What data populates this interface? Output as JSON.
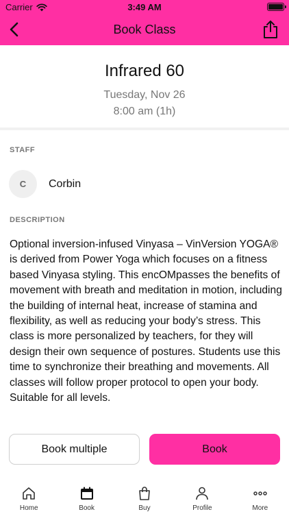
{
  "status_bar": {
    "carrier": "Carrier",
    "time": "3:49 AM",
    "battery_level": 1.0
  },
  "header": {
    "title": "Book Class",
    "back_icon": "chevron-left-icon",
    "share_icon": "share-icon"
  },
  "class_info": {
    "name": "Infrared 60",
    "date": "Tuesday, Nov 26",
    "time": "8:00 am (1h)"
  },
  "staff": {
    "section_label": "STAFF",
    "initial": "C",
    "name": "Corbin"
  },
  "description": {
    "section_label": "DESCRIPTION",
    "text": "Optional inversion-infused Vinyasa – VinVersion YOGA® is derived from Power Yoga which focuses on a fitness based Vinyasa styling.  This encOMpasses the benefits of movement with breath and meditation in motion, including the building of internal heat, increase of stamina and flexibility, as well as reducing your body’s stress. This class is more personalized by teachers, for they will design their own sequence of postures. Students use this time to synchronize their breathing and movements. All classes will follow proper protocol to open your body.  Suitable for all levels."
  },
  "actions": {
    "book_multiple_label": "Book multiple",
    "book_label": "Book"
  },
  "tabbar": {
    "items": [
      {
        "label": "Home",
        "icon": "home-icon"
      },
      {
        "label": "Book",
        "icon": "calendar-icon",
        "active": true
      },
      {
        "label": "Buy",
        "icon": "shopping-bag-icon"
      },
      {
        "label": "Profile",
        "icon": "person-icon"
      },
      {
        "label": "More",
        "icon": "ellipsis-icon"
      }
    ]
  },
  "colors": {
    "accent": "#ff2fa3",
    "muted_text": "#777777",
    "divider": "#f1f1f1"
  }
}
